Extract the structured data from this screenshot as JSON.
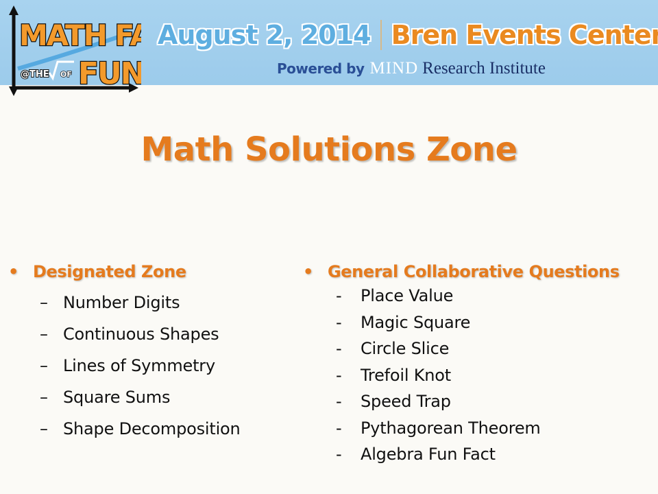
{
  "banner": {
    "logo": {
      "line1": "MATH FAIR",
      "line2": "@THE",
      "line3": "OF",
      "line4": "FUN"
    },
    "date": "August 2, 2014",
    "venue": "Bren Events Center, UC Irvine",
    "powered_by": "Powered by",
    "org_a": "MIND",
    "org_b": "Research Institute"
  },
  "title": "Math Solutions Zone",
  "left": {
    "bullet": "•",
    "heading": "Designated Zone",
    "marker": "–",
    "items": [
      "Number Digits",
      "Continuous  Shapes",
      "Lines of Symmetry",
      "Square Sums",
      "Shape Decomposition"
    ]
  },
  "right": {
    "bullet": "•",
    "heading": "General Collaborative Questions",
    "marker": "-",
    "items": [
      "Place Value",
      "Magic Square",
      "Circle Slice",
      "Trefoil Knot",
      "Speed Trap",
      "Pythagorean Theorem",
      "Algebra Fun Fact"
    ]
  },
  "colors": {
    "accent_orange": "#e57b1e",
    "banner_blue": "#9ccbeb",
    "date_blue": "#5eaee0",
    "powered_blue": "#2a4f96"
  }
}
